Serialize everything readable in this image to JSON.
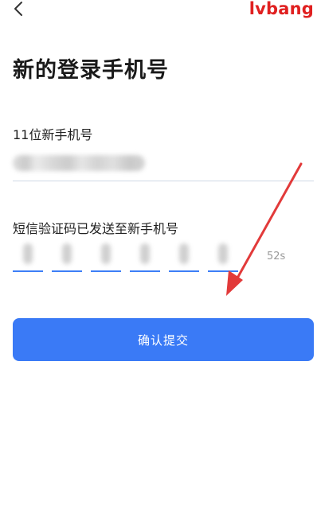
{
  "header": {
    "back_icon": "chevron-left-icon",
    "watermark": "lvbang"
  },
  "title": "新的登录手机号",
  "phone": {
    "label": "11位新手机号",
    "value_obscured": true
  },
  "code": {
    "label": "短信验证码已发送至新手机号",
    "digits_count": 6,
    "countdown": "52s"
  },
  "submit": {
    "label": "确认提交"
  },
  "colors": {
    "primary": "#3a7af6",
    "code_underline": "#3d7ef7",
    "watermark": "#e02020",
    "annotation_arrow": "#e23a3a"
  }
}
